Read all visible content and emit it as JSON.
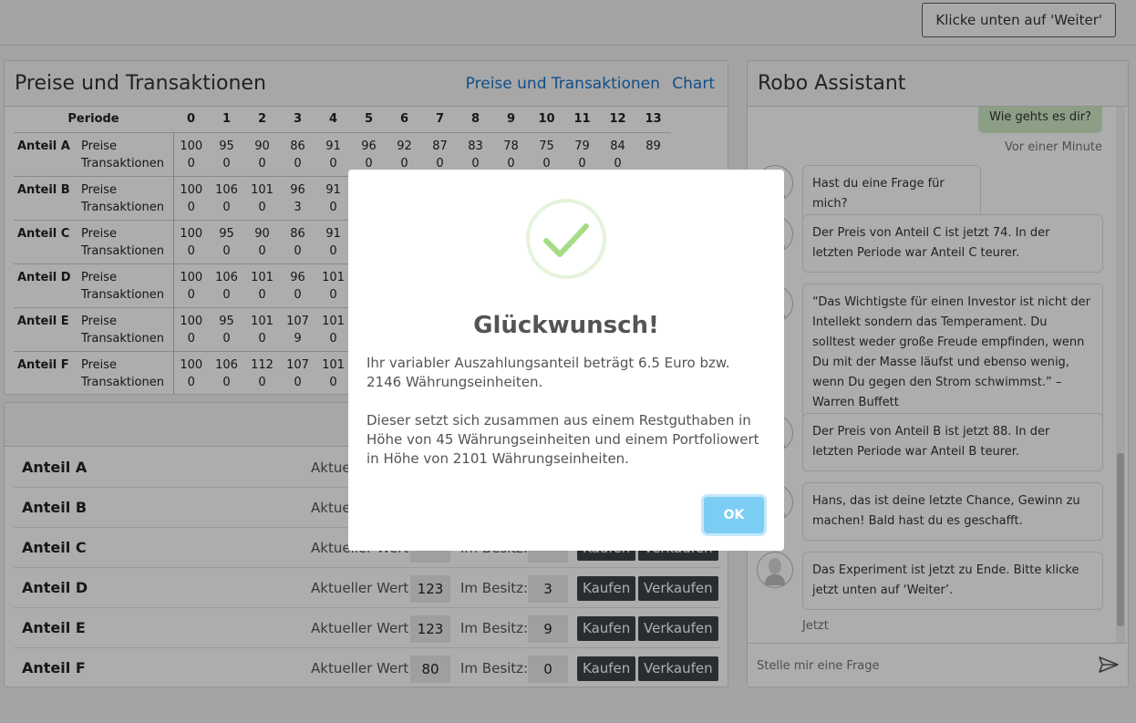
{
  "topbar": {
    "weiter_button": "Klicke unten auf 'Weiter'"
  },
  "prices_panel": {
    "title": "Preise und Transaktionen",
    "link_table": "Preise und Transaktionen",
    "link_chart": "Chart",
    "periode_header": "Periode",
    "periods": [
      "0",
      "1",
      "2",
      "3",
      "4",
      "5",
      "6",
      "7",
      "8",
      "9",
      "10",
      "11",
      "12",
      "13"
    ],
    "row_label_prices": "Preise",
    "row_label_trans": "Transaktionen",
    "assets": [
      {
        "name": "Anteil A",
        "prices": [
          "100",
          "95",
          "90",
          "86",
          "91",
          "96",
          "92",
          "87",
          "83",
          "78",
          "75",
          "79",
          "84",
          "89"
        ],
        "trans": [
          "0",
          "0",
          "0",
          "0",
          "0",
          "0",
          "0",
          "0",
          "0",
          "0",
          "0",
          "0",
          "0",
          ""
        ]
      },
      {
        "name": "Anteil B",
        "prices": [
          "100",
          "106",
          "101",
          "96",
          "91",
          "",
          "",
          "",
          "",
          "",
          "",
          "",
          "",
          ""
        ],
        "trans": [
          "0",
          "0",
          "0",
          "3",
          "0",
          "",
          "",
          "",
          "",
          "",
          "",
          "",
          "",
          ""
        ]
      },
      {
        "name": "Anteil C",
        "prices": [
          "100",
          "95",
          "90",
          "86",
          "91",
          "",
          "",
          "",
          "",
          "",
          "",
          "",
          "",
          ""
        ],
        "trans": [
          "0",
          "0",
          "0",
          "0",
          "0",
          "",
          "",
          "",
          "",
          "",
          "",
          "",
          "",
          ""
        ]
      },
      {
        "name": "Anteil D",
        "prices": [
          "100",
          "106",
          "101",
          "96",
          "101",
          "",
          "",
          "",
          "",
          "",
          "",
          "",
          "",
          ""
        ],
        "trans": [
          "0",
          "0",
          "0",
          "0",
          "0",
          "",
          "",
          "",
          "",
          "",
          "",
          "",
          "",
          ""
        ]
      },
      {
        "name": "Anteil E",
        "prices": [
          "100",
          "95",
          "101",
          "107",
          "101",
          "",
          "",
          "",
          "",
          "",
          "",
          "",
          "",
          ""
        ],
        "trans": [
          "0",
          "0",
          "0",
          "9",
          "0",
          "",
          "",
          "",
          "",
          "",
          "",
          "",
          "",
          ""
        ]
      },
      {
        "name": "Anteil F",
        "prices": [
          "100",
          "106",
          "112",
          "107",
          "101",
          "",
          "",
          "",
          "",
          "",
          "",
          "",
          "",
          ""
        ],
        "trans": [
          "0",
          "0",
          "0",
          "0",
          "0",
          "",
          "",
          "",
          "",
          "",
          "",
          "",
          "",
          ""
        ]
      }
    ]
  },
  "trade_panel": {
    "label_value": "Aktueller Wert:",
    "label_owned": "Im Besitz:",
    "buy": "Kaufen",
    "sell": "Verkaufen",
    "rows": [
      {
        "name": "Anteil A",
        "value": "",
        "owned": ""
      },
      {
        "name": "Anteil B",
        "value": "",
        "owned": ""
      },
      {
        "name": "Anteil C",
        "value": "",
        "owned": ""
      },
      {
        "name": "Anteil D",
        "value": "123",
        "owned": "3"
      },
      {
        "name": "Anteil E",
        "value": "123",
        "owned": "9"
      },
      {
        "name": "Anteil F",
        "value": "80",
        "owned": "0"
      }
    ]
  },
  "robo": {
    "title": "Robo Assistant",
    "user_msg": "Wie gehts es dir?",
    "user_time": "Vor einer Minute",
    "messages": [
      "Hast du eine Frage für mich?",
      "Der Preis von Anteil C ist jetzt 74. In der letzten Periode war Anteil C teurer.",
      "“Das Wichtigste für einen Investor ist nicht der Intellekt sondern das Temperament. Du solltest weder große Freude empfinden, wenn Du mit der Masse läufst und ebenso wenig, wenn Du gegen den Strom schwimmst.” – Warren Buffett",
      "Der Preis von Anteil B ist jetzt 88. In der letzten Periode war Anteil B teurer.",
      "Hans, das ist deine letzte Chance, Gewinn zu machen! Bald hast du es geschafft.",
      "Das Experiment ist jetzt zu Ende. Bitte klicke jetzt unten auf ‘Weiter’."
    ],
    "last_time": "Jetzt",
    "input_placeholder": "Stelle mir eine Frage"
  },
  "modal": {
    "title": "Glückwunsch!",
    "text1": "Ihr variabler Auszahlungsanteil beträgt 6.5 Euro bzw. 2146 Währungseinheiten.",
    "text2": "Dieser setzt sich zusammen aus einem Restguthaben in Höhe von 45 Währungseinheiten und einem Portfoliowert in Höhe von 2101 Währungseinheiten.",
    "ok": "OK"
  },
  "colors": {
    "accent_link": "#1a73c8",
    "button_dark": "#3d434a",
    "ok_button": "#7ccdf4",
    "check_green": "#a5dc86",
    "user_bubble": "#cfeac6"
  }
}
